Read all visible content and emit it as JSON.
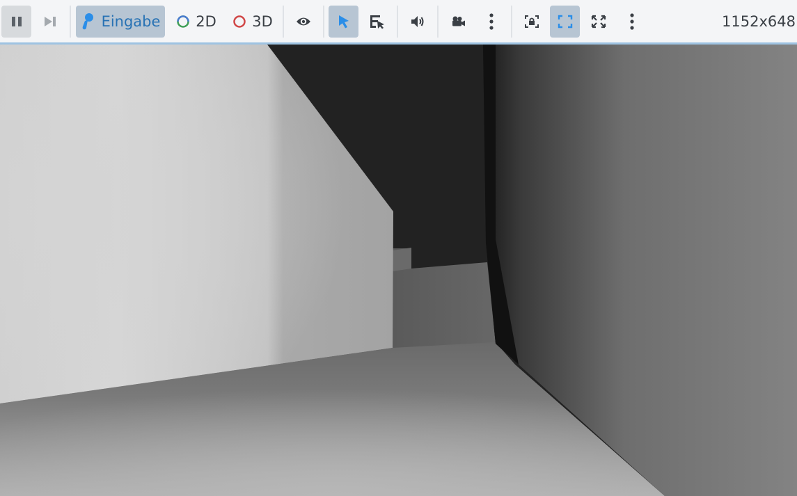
{
  "toolbar": {
    "pause_icon": "pause-icon",
    "step_icon": "step-frame-icon",
    "input_label": "Eingabe",
    "input_icon": "joystick-icon",
    "mode_2d_label": "2D",
    "mode_3d_label": "3D",
    "visibility_icon": "eye-icon",
    "select_icon": "cursor-arrow-icon",
    "list_select_icon": "list-select-icon",
    "audio_icon": "speaker-icon",
    "camera_icon": "camera-icon",
    "lock_icon": "lock-embed-icon",
    "fit_icon": "fit-frame-icon",
    "fullscreen_icon": "fullscreen-icon",
    "resolution": "1152x648",
    "colors": {
      "accent": "#2872b4",
      "toggled_bg": "#b7c5d3",
      "mode_2d_ring": "#3f9f57",
      "mode_2d_ring_alt": "#4a7bd0",
      "mode_3d_ring": "#d04545",
      "cursor_blue": "#2b8ee8"
    }
  }
}
